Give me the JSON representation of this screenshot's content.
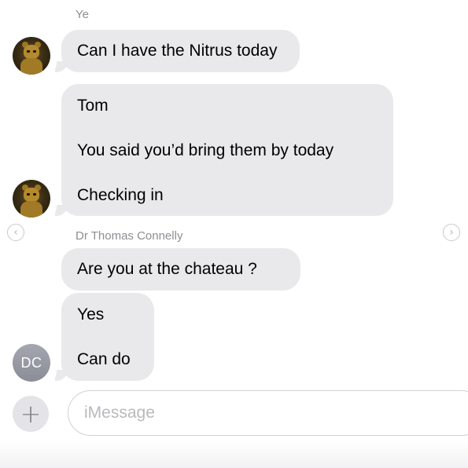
{
  "conversation": {
    "groups": [
      {
        "sender": "Ye",
        "messages": [
          "Can I have the Nitrus today"
        ]
      },
      {
        "sender": "",
        "messages": [
          "Tom",
          "You said you’d bring them by today",
          "Checking in"
        ]
      },
      {
        "sender": "Dr Thomas Connelly",
        "messages": [
          "Are you at the chateau ?",
          "Yes",
          "Can do"
        ]
      }
    ],
    "avatar_initials": "DC"
  },
  "nav": {
    "prev_icon": "chevron-left-icon",
    "prev_glyph": "‹",
    "next_icon": "chevron-right-icon",
    "next_glyph": "›"
  },
  "composer": {
    "add_glyph": "+",
    "placeholder": "iMessage",
    "value": ""
  },
  "colors": {
    "bubble": "#e9e9eb",
    "name_text": "#8e8e93",
    "avatar_initials_bg": "#9a9da6"
  }
}
